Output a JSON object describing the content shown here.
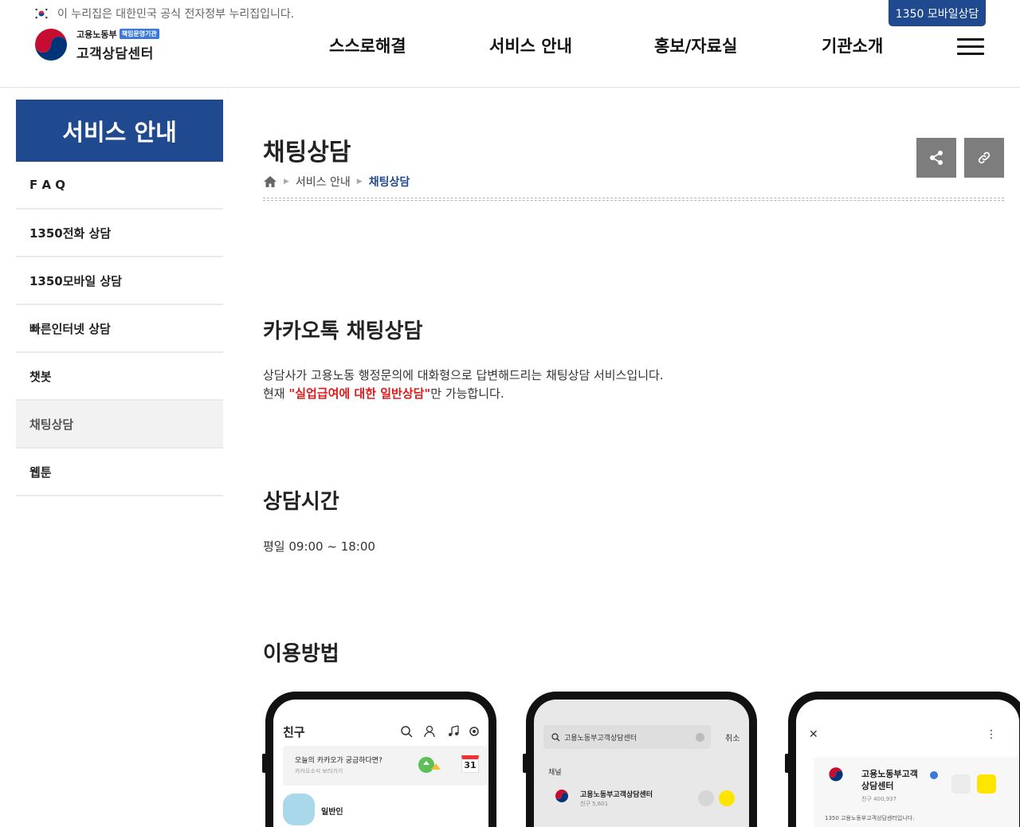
{
  "header": {
    "gov_notice": "이 누리집은 대한민국 공식 전자정부 누리집입니다.",
    "mobile_consult": "1350 모바일상담",
    "logo_ministry": "고용노동부",
    "logo_badge": "책임운영기관",
    "logo_title": "고객상담센터",
    "nav": [
      "스스로해결",
      "서비스 안내",
      "홍보/자료실",
      "기관소개"
    ]
  },
  "sidebar": {
    "title": "서비스 안내",
    "items": [
      "F A Q",
      "1350전화 상담",
      "1350모바일 상담",
      "빠른인터넷 상담",
      "챗봇",
      "채팅상담",
      "웹툰"
    ],
    "active": "채팅상담"
  },
  "content": {
    "page_title": "채팅상담",
    "breadcrumb": [
      "서비스 안내",
      "채팅상담"
    ],
    "section1_title": "카카오톡 채팅상담",
    "section1_line1": "상담사가 고용노동 행정문의에 대화형으로 답변해드리는 채팅상담 서비스입니다.",
    "section1_line2_pre": "현재 ",
    "section1_line2_em": "\"실업급여에 대한 일반상담\"",
    "section1_line2_post": "만 가능합니다.",
    "section2_title": "상담시간",
    "section2_text": "평일 09:00 ~ 18:00",
    "section3_title": "이용방법"
  },
  "phones": {
    "p1": {
      "title": "친구",
      "banner_title": "오늘의 카카오가 궁금하다면?",
      "banner_sub": "카카오소식 보러가기",
      "calendar_day": "31",
      "profile_name": "일반인"
    },
    "p2": {
      "search_text": "고용노동부고객상담센터",
      "cancel": "취소",
      "section_label": "채널",
      "channel_name": "고용노동부고객상담센터",
      "channel_friends": "친구 5,601"
    },
    "p3": {
      "channel_name_1": "고용노동부고객",
      "channel_name_2": "상담센터",
      "friends": "친구 400,937",
      "desc": "1350 고용노동부고객상담센터입니다."
    }
  },
  "colors": {
    "primary": "#1f4a8f",
    "accent_red": "#e01a1a",
    "kakao_yellow": "#fee500"
  }
}
